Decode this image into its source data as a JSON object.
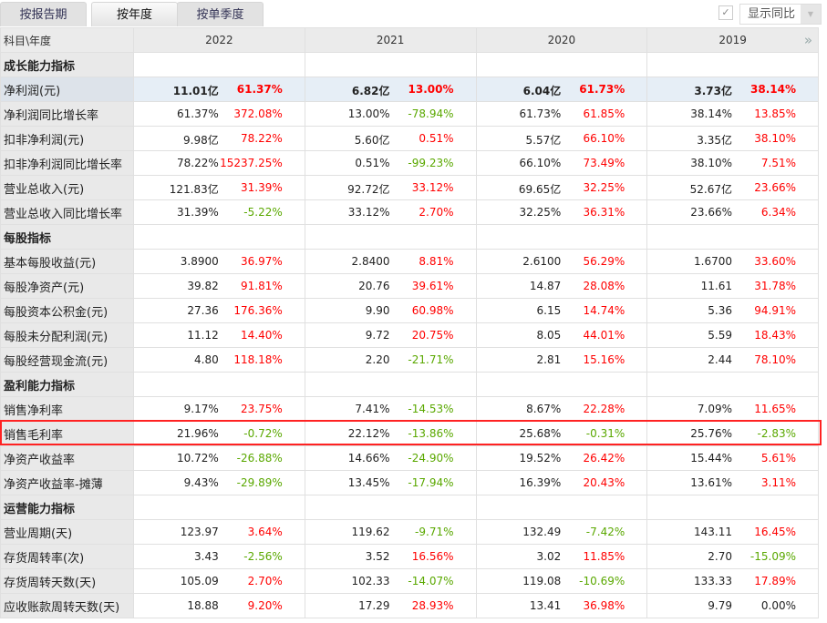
{
  "tabs": [
    "按报告期",
    "按年度",
    "按单季度"
  ],
  "active_tab": 1,
  "show_yoy": {
    "label": "显示同比",
    "checked": true
  },
  "header": {
    "label": "科目\\年度",
    "years": [
      "2022",
      "2021",
      "2020",
      "2019"
    ]
  },
  "rows": [
    {
      "type": "section",
      "label": "成长能力指标"
    },
    {
      "type": "hl",
      "label": "净利润(元)",
      "cells": [
        [
          "11.01亿",
          "61.37%"
        ],
        [
          "6.82亿",
          "13.00%"
        ],
        [
          "6.04亿",
          "61.73%"
        ],
        [
          "3.73亿",
          "38.14%"
        ]
      ]
    },
    {
      "label": "净利润同比增长率",
      "cells": [
        [
          "61.37%",
          "372.08%"
        ],
        [
          "13.00%",
          "-78.94%"
        ],
        [
          "61.73%",
          "61.85%"
        ],
        [
          "38.14%",
          "13.85%"
        ]
      ]
    },
    {
      "label": "扣非净利润(元)",
      "cells": [
        [
          "9.98亿",
          "78.22%"
        ],
        [
          "5.60亿",
          "0.51%"
        ],
        [
          "5.57亿",
          "66.10%"
        ],
        [
          "3.35亿",
          "38.10%"
        ]
      ]
    },
    {
      "label": "扣非净利润同比增长率",
      "cells": [
        [
          "78.22%",
          "15237.25%"
        ],
        [
          "0.51%",
          "-99.23%"
        ],
        [
          "66.10%",
          "73.49%"
        ],
        [
          "38.10%",
          "7.51%"
        ]
      ]
    },
    {
      "label": "营业总收入(元)",
      "cells": [
        [
          "121.83亿",
          "31.39%"
        ],
        [
          "92.72亿",
          "33.12%"
        ],
        [
          "69.65亿",
          "32.25%"
        ],
        [
          "52.67亿",
          "23.66%"
        ]
      ]
    },
    {
      "label": "营业总收入同比增长率",
      "cells": [
        [
          "31.39%",
          "-5.22%"
        ],
        [
          "33.12%",
          "2.70%"
        ],
        [
          "32.25%",
          "36.31%"
        ],
        [
          "23.66%",
          "6.34%"
        ]
      ]
    },
    {
      "type": "section",
      "label": "每股指标"
    },
    {
      "label": "基本每股收益(元)",
      "cells": [
        [
          "3.8900",
          "36.97%"
        ],
        [
          "2.8400",
          "8.81%"
        ],
        [
          "2.6100",
          "56.29%"
        ],
        [
          "1.6700",
          "33.60%"
        ]
      ]
    },
    {
      "label": "每股净资产(元)",
      "cells": [
        [
          "39.82",
          "91.81%"
        ],
        [
          "20.76",
          "39.61%"
        ],
        [
          "14.87",
          "28.08%"
        ],
        [
          "11.61",
          "31.78%"
        ]
      ]
    },
    {
      "label": "每股资本公积金(元)",
      "cells": [
        [
          "27.36",
          "176.36%"
        ],
        [
          "9.90",
          "60.98%"
        ],
        [
          "6.15",
          "14.74%"
        ],
        [
          "5.36",
          "94.91%"
        ]
      ]
    },
    {
      "label": "每股未分配利润(元)",
      "cells": [
        [
          "11.12",
          "14.40%"
        ],
        [
          "9.72",
          "20.75%"
        ],
        [
          "8.05",
          "44.01%"
        ],
        [
          "5.59",
          "18.43%"
        ]
      ]
    },
    {
      "label": "每股经营现金流(元)",
      "cells": [
        [
          "4.80",
          "118.18%"
        ],
        [
          "2.20",
          "-21.71%"
        ],
        [
          "2.81",
          "15.16%"
        ],
        [
          "2.44",
          "78.10%"
        ]
      ]
    },
    {
      "type": "section",
      "label": "盈利能力指标"
    },
    {
      "label": "销售净利率",
      "cells": [
        [
          "9.17%",
          "23.75%"
        ],
        [
          "7.41%",
          "-14.53%"
        ],
        [
          "8.67%",
          "22.28%"
        ],
        [
          "7.09%",
          "11.65%"
        ]
      ]
    },
    {
      "label": "销售毛利率",
      "highlighted": true,
      "cells": [
        [
          "21.96%",
          "-0.72%"
        ],
        [
          "22.12%",
          "-13.86%"
        ],
        [
          "25.68%",
          "-0.31%"
        ],
        [
          "25.76%",
          "-2.83%"
        ]
      ]
    },
    {
      "label": "净资产收益率",
      "cells": [
        [
          "10.72%",
          "-26.88%"
        ],
        [
          "14.66%",
          "-24.90%"
        ],
        [
          "19.52%",
          "26.42%"
        ],
        [
          "15.44%",
          "5.61%"
        ]
      ]
    },
    {
      "label": "净资产收益率-摊薄",
      "cells": [
        [
          "9.43%",
          "-29.89%"
        ],
        [
          "13.45%",
          "-17.94%"
        ],
        [
          "16.39%",
          "20.43%"
        ],
        [
          "13.61%",
          "3.11%"
        ]
      ]
    },
    {
      "type": "section",
      "label": "运营能力指标"
    },
    {
      "label": "营业周期(天)",
      "cells": [
        [
          "123.97",
          "3.64%"
        ],
        [
          "119.62",
          "-9.71%"
        ],
        [
          "132.49",
          "-7.42%"
        ],
        [
          "143.11",
          "16.45%"
        ]
      ]
    },
    {
      "label": "存货周转率(次)",
      "cells": [
        [
          "3.43",
          "-2.56%"
        ],
        [
          "3.52",
          "16.56%"
        ],
        [
          "3.02",
          "11.85%"
        ],
        [
          "2.70",
          "-15.09%"
        ]
      ]
    },
    {
      "label": "存货周转天数(天)",
      "cells": [
        [
          "105.09",
          "2.70%"
        ],
        [
          "102.33",
          "-14.07%"
        ],
        [
          "119.08",
          "-10.69%"
        ],
        [
          "133.33",
          "17.89%"
        ]
      ]
    },
    {
      "label": "应收账款周转天数(天)",
      "cells": [
        [
          "18.88",
          "9.20%"
        ],
        [
          "17.29",
          "28.93%"
        ],
        [
          "13.41",
          "36.98%"
        ],
        [
          "9.79",
          "0.00%"
        ]
      ]
    }
  ],
  "colors": {
    "up": "#ff0000",
    "down": "#5aa800",
    "highlight_box": "#ff2222"
  }
}
